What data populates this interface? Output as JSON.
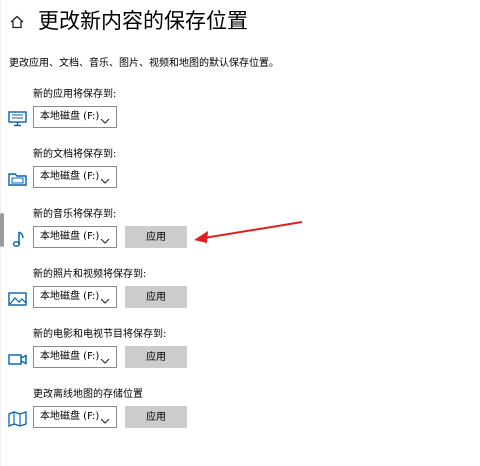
{
  "header": {
    "title": "更改新内容的保存位置"
  },
  "description": "更改应用、文档、音乐、图片、视频和地图的默认保存位置。",
  "colors": {
    "accent": "#0063b1",
    "arrow": "#e02020",
    "button_bg": "#cccccc"
  },
  "sections": [
    {
      "label": "新的应用将保存到:",
      "drive": "本地磁盘 (F:)",
      "apply": "",
      "icon": "monitor-icon"
    },
    {
      "label": "新的文档将保存到:",
      "drive": "本地磁盘 (F:)",
      "apply": "",
      "icon": "document-folder-icon"
    },
    {
      "label": "新的音乐将保存到:",
      "drive": "本地磁盘 (F:)",
      "apply": "应用",
      "icon": "music-note-icon"
    },
    {
      "label": "新的照片和视频将保存到:",
      "drive": "本地磁盘 (F:)",
      "apply": "应用",
      "icon": "picture-icon"
    },
    {
      "label": "新的电影和电视节目将保存到:",
      "drive": "本地磁盘 (F:)",
      "apply": "应用",
      "icon": "video-camera-icon"
    },
    {
      "label": "更改离线地图的存储位置",
      "drive": "本地磁盘 (F:)",
      "apply": "应用",
      "icon": "map-icon"
    }
  ]
}
